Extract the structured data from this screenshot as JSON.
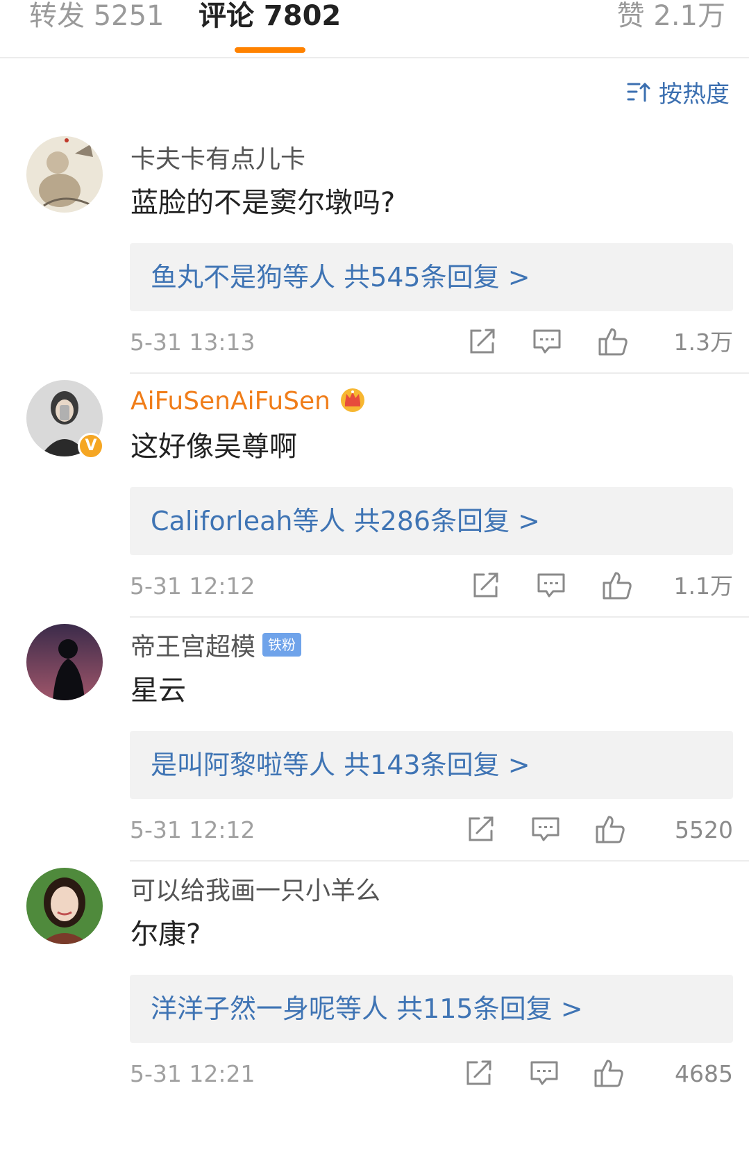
{
  "tabs": {
    "forward": "转发 5251",
    "comments": "评论 7802",
    "likes": "赞 2.1万"
  },
  "sort": {
    "label": "按热度",
    "icon": "sort-hot-icon"
  },
  "colors": {
    "accent": "#ff8200",
    "link": "#3f74b4",
    "vip_name": "#f07d19"
  },
  "comments": [
    {
      "username": "卡夫卡有点儿卡",
      "text": "蓝脸的不是窦尔墩吗?",
      "reply_summary": "鱼丸不是狗等人  共545条回复 >",
      "timestamp": "5-31 13:13",
      "likes": "1.3万"
    },
    {
      "username": "AiFuSenAiFuSen",
      "badge_icon": "crown-icon",
      "verified_icon": "verified-v-icon",
      "verified_mark": "V",
      "text": "这好像吴尊啊",
      "reply_summary": "Califorleah等人  共286条回复 >",
      "timestamp": "5-31 12:12",
      "likes": "1.1万"
    },
    {
      "username": "帝王宫超模",
      "fan_badge": "铁粉",
      "text": "星云",
      "reply_summary": "是叫阿黎啦等人  共143条回复 >",
      "timestamp": "5-31 12:12",
      "likes": "5520"
    },
    {
      "username": "可以给我画一只小羊么",
      "text": "尔康?",
      "reply_summary": "洋洋子然一身呢等人  共115条回复 >",
      "timestamp": "5-31 12:21",
      "likes": "4685"
    }
  ]
}
